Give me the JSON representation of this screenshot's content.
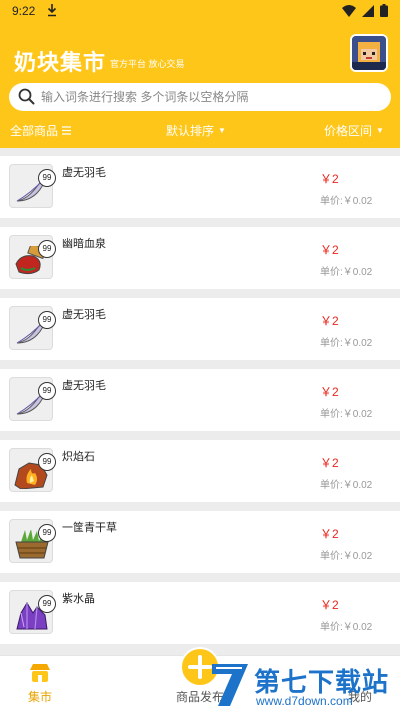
{
  "status_bar": {
    "time": "9:22"
  },
  "header": {
    "title": "奶块集市",
    "subtitle": "官方平台 放心交易",
    "search_placeholder": "输入词条进行搜索 多个词条以空格分隔"
  },
  "filters": {
    "all_goods": "全部商品",
    "sort": "默认排序",
    "price_range": "价格区间"
  },
  "items": [
    {
      "name": "虚无羽毛",
      "qty": "99",
      "price": "￥2",
      "unit_price": "单价:￥0.02",
      "icon": "feather-icon"
    },
    {
      "name": "幽暗血泉",
      "qty": "99",
      "price": "￥2",
      "unit_price": "单价:￥0.02",
      "icon": "blood-potion-icon"
    },
    {
      "name": "虚无羽毛",
      "qty": "99",
      "price": "￥2",
      "unit_price": "单价:￥0.02",
      "icon": "feather-icon"
    },
    {
      "name": "虚无羽毛",
      "qty": "99",
      "price": "￥2",
      "unit_price": "单价:￥0.02",
      "icon": "feather-icon"
    },
    {
      "name": "炽焰石",
      "qty": "99",
      "price": "￥2",
      "unit_price": "单价:￥0.02",
      "icon": "flame-stone-icon"
    },
    {
      "name": "一筐青干草",
      "qty": "99",
      "price": "￥2",
      "unit_price": "单价:￥0.02",
      "icon": "hay-basket-icon"
    },
    {
      "name": "紫水晶",
      "qty": "99",
      "price": "￥2",
      "unit_price": "单价:￥0.02",
      "icon": "amethyst-icon"
    }
  ],
  "bottom_nav": {
    "market": "集市",
    "publish": "商品发布",
    "me": "我的"
  },
  "watermark": {
    "brand": "第七下载站",
    "url": "www.d7down.com"
  },
  "colors": {
    "accent": "#ffc61a",
    "price": "#e8271d",
    "watermark": "#1d73c9"
  }
}
